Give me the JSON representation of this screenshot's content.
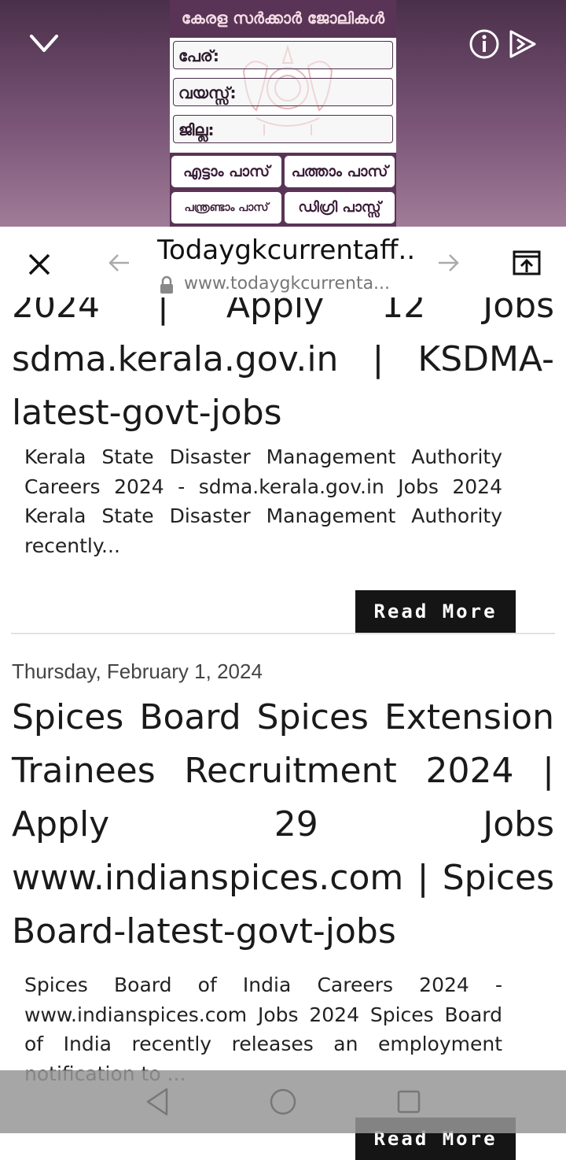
{
  "ad": {
    "title": "കേരള സർക്കാർ ജോലികൾ",
    "fields": [
      "പേര്:",
      "വയസ്സ്:",
      "ജില്ല:"
    ],
    "buttons": [
      "എട്ടാം പാസ്",
      "പത്താം പാസ്",
      "പന്ത്രണ്ടാം പാസ്",
      "ഡിഗ്രി പാസ്സ്"
    ],
    "icons": [
      "chevron-down-icon",
      "info-icon",
      "ad-choices-icon"
    ]
  },
  "toolbar": {
    "title": "Todaygkcurrentaff...",
    "url": "www.todaygkcurrenta...",
    "icons": [
      "close-icon",
      "back-arrow-icon",
      "forward-arrow-icon",
      "lock-icon",
      "open-in-browser-icon"
    ]
  },
  "posts": [
    {
      "title": "2024 | Apply 12 Jobs sdma.kerala.gov.in | KSDMA-latest-govt-jobs",
      "snippet": "Kerala State Disaster Management Authority Careers 2024 - sdma.kerala.gov.in Jobs 2024 Kerala State Disaster Management Authority recently...",
      "read_more": "Read More"
    },
    {
      "date": "Thursday, February 1, 2024",
      "title": "Spices Board Spices Extension Trainees Recruitment 2024 | Apply 29 Jobs www.indianspices.com | Spices Board-latest-govt-jobs",
      "snippet": "Spices Board of India Careers 2024 - www.indianspices.com Jobs 2024 Spices Board of India recently releases an employment notification to ...",
      "read_more": "Read More"
    }
  ],
  "navbar": {
    "icons": [
      "nav-back-icon",
      "nav-home-icon",
      "nav-recents-icon"
    ]
  },
  "colors": {
    "ad_bg": "#7a5577",
    "ad_card_header": "#5a3456",
    "button_bg": "#151515"
  }
}
